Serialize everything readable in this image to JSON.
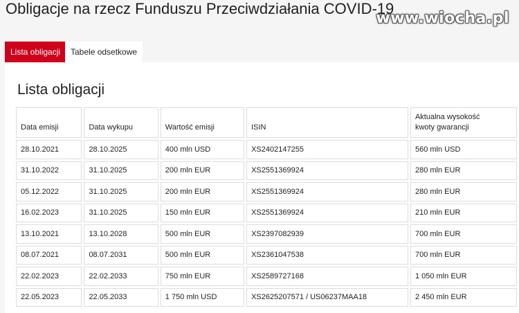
{
  "page_title": "Obligacje na rzecz Funduszu Przeciwdziałania COVID-19",
  "watermark": "www.wiocha.pl",
  "tabs": [
    {
      "label": "Lista obligacji",
      "active": true
    },
    {
      "label": "Tabele odsetkowe",
      "active": false
    }
  ],
  "section_title": "Lista obligacji",
  "table": {
    "headers": [
      "Data emisji",
      "Data wykupu",
      "Wartość emisji",
      "ISIN",
      "Aktualna wysokość kwoty gwarancji"
    ],
    "header_last_line1": "Aktualna wysokość",
    "header_last_line2": "kwoty gwarancji",
    "rows": [
      [
        "28.10.2021",
        "28.10.2025",
        "400 mln USD",
        "XS2402147255",
        "560 mln USD"
      ],
      [
        "31.10.2022",
        "31.10.2025",
        "200 mln EUR",
        "XS2551369924",
        "280 mln EUR"
      ],
      [
        "05.12.2022",
        "31.10.2025",
        "200 mln EUR",
        "XS2551369924",
        "280 mln EUR"
      ],
      [
        "16.02.2023",
        "31.10.2025",
        "150 mln EUR",
        "XS2551369924",
        "210 mln EUR"
      ],
      [
        "13.10.2021",
        "13.10.2028",
        "500 mln EUR",
        "XS2397082939",
        "700 mln EUR"
      ],
      [
        "08.07.2021",
        "08.07.2031",
        "500 mln EUR",
        "XS2361047538",
        "700 mln EUR"
      ],
      [
        "22.02.2023",
        "22.02.2033",
        "750 mln EUR",
        "XS2589727168",
        "1 050 mln EUR"
      ],
      [
        "22.05.2023",
        "22.05.2033",
        "1 750 mln USD",
        "XS2625207571 / US06237MAA18",
        "2 450 mln EUR"
      ]
    ]
  },
  "colors": {
    "accent": "#d0021b",
    "background": "#f5f5f5",
    "panel": "#ffffff",
    "border": "#dcdcdc"
  }
}
